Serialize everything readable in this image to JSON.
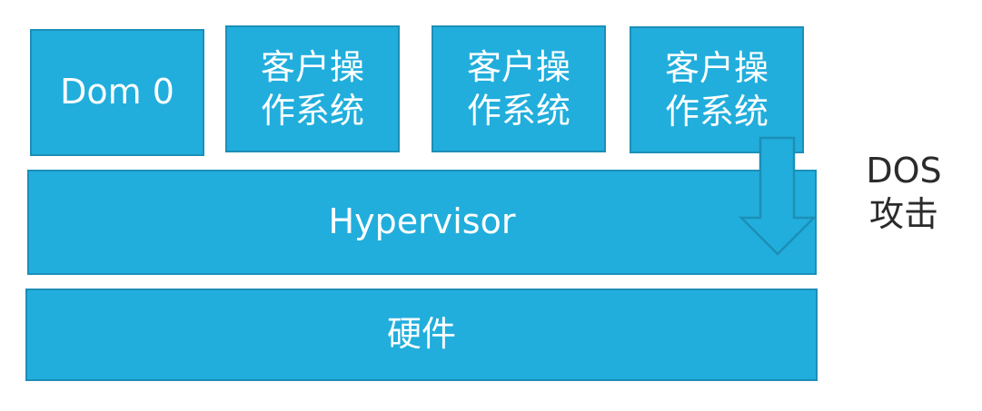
{
  "diagram": {
    "dom0_label": "Dom 0",
    "guest_os": [
      {
        "label": "客户操作系统"
      },
      {
        "label": "客户操作系统"
      },
      {
        "label": "客户操作系统"
      }
    ],
    "hypervisor_label": "Hypervisor",
    "hardware_label": "硬件",
    "attack_label": "DOS攻击"
  },
  "colors": {
    "block_fill": "#21AEDC",
    "block_border": "#1C8FB7",
    "label_text": "#2b2b2b"
  },
  "icons": {
    "attack_arrow": "down-arrow-icon"
  }
}
